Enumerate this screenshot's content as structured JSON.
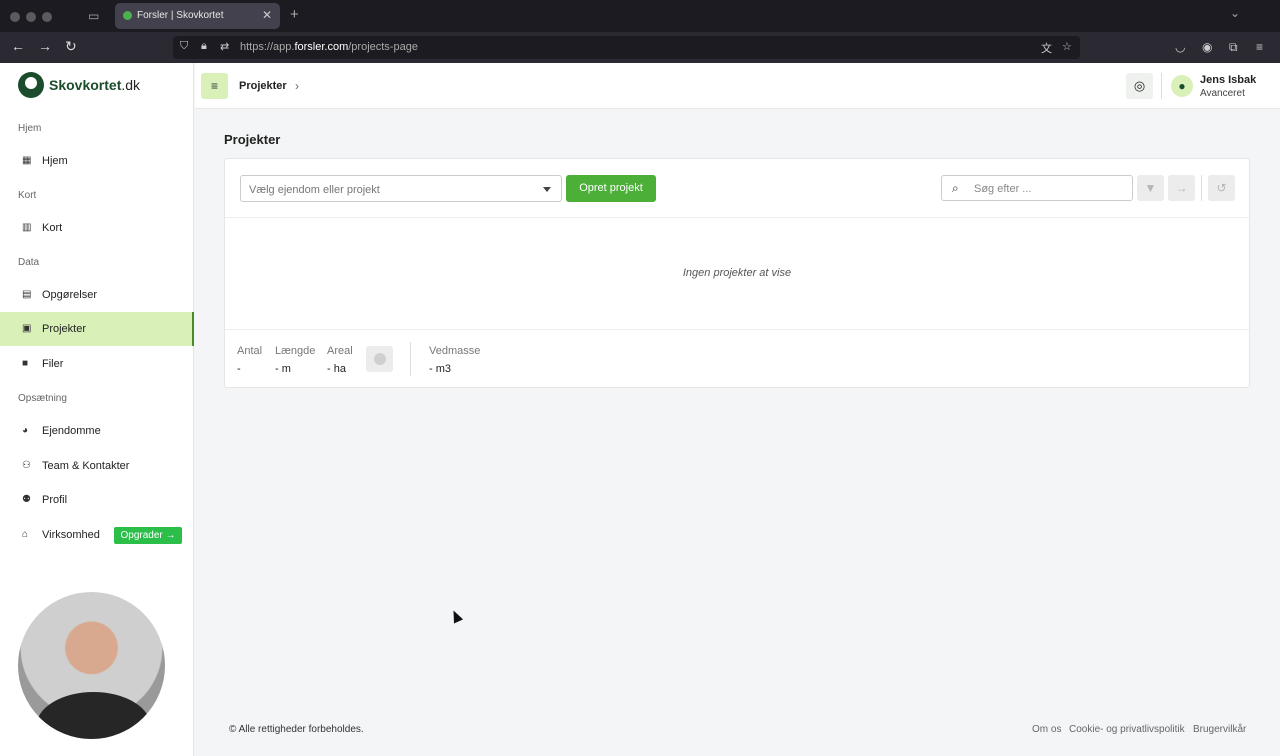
{
  "browser": {
    "tab_title": "Forsler | Skovkortet",
    "url_prefix": "https://app.",
    "url_host": "forsler.com",
    "url_path": "/projects-page"
  },
  "brand": {
    "name_bold": "Skovkortet",
    "name_suffix": ".dk",
    "color": "#1b4d2c"
  },
  "sidebar": {
    "sections": [
      "Hjem",
      "Kort",
      "Data",
      "Opsætning"
    ],
    "items": [
      {
        "label": "Hjem",
        "icon": "dashboard-icon"
      },
      {
        "label": "Kort",
        "icon": "map-icon"
      },
      {
        "label": "Opgørelser",
        "icon": "table-icon"
      },
      {
        "label": "Projekter",
        "icon": "clipboard-icon",
        "active": true
      },
      {
        "label": "Filer",
        "icon": "folder-icon"
      },
      {
        "label": "Ejendomme",
        "icon": "property-icon"
      },
      {
        "label": "Team & Kontakter",
        "icon": "team-icon"
      },
      {
        "label": "Profil",
        "icon": "profile-icon"
      },
      {
        "label": "Virksomhed",
        "icon": "home-icon"
      }
    ],
    "upgrade_label": "Opgrader →",
    "active_color": "#d9f0b8"
  },
  "topbar": {
    "breadcrumb": "Projekter",
    "user_name": "Jens Isbak",
    "user_role": "Avanceret"
  },
  "main": {
    "title": "Projekter",
    "select_placeholder": "Vælg ejendom eller projekt",
    "create_label": "Opret projekt",
    "search_placeholder": "Søg efter ...",
    "empty_text": "Ingen projekter at vise",
    "stats": [
      {
        "label": "Antal",
        "value": "-"
      },
      {
        "label": "Længde",
        "value": "- m"
      },
      {
        "label": "Areal",
        "value": "- ha"
      },
      {
        "label": "Vedmasse",
        "value": "- m3"
      }
    ],
    "accent_color": "#4caf38"
  },
  "footer": {
    "copyright": "© Alle rettigheder forbeholdes.",
    "links": [
      "Om os",
      "Cookie- og privatlivspolitik",
      "Brugervilkår"
    ]
  }
}
